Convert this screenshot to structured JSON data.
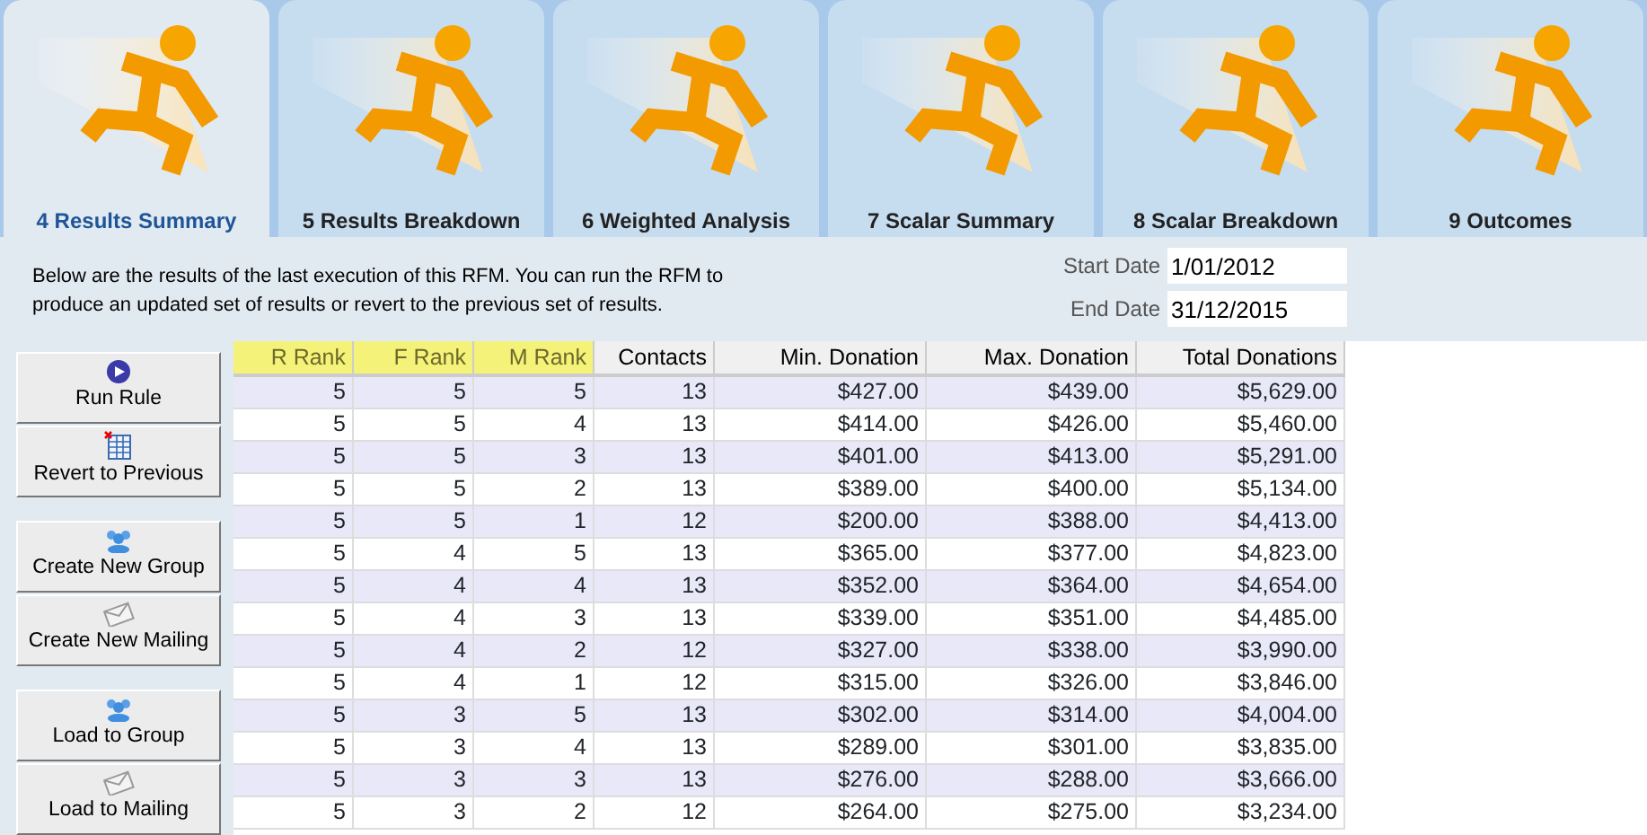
{
  "tabs": [
    {
      "label": "4 Results Summary",
      "selected": true
    },
    {
      "label": "5 Results Breakdown",
      "selected": false
    },
    {
      "label": "6 Weighted Analysis",
      "selected": false
    },
    {
      "label": "7 Scalar Summary",
      "selected": false
    },
    {
      "label": "8 Scalar Breakdown",
      "selected": false
    },
    {
      "label": "9 Outcomes",
      "selected": false
    }
  ],
  "description": "Below are the results of the last execution of this RFM. You can run the RFM to produce an updated set of results or revert to the previous set of results.",
  "date_fields": [
    {
      "label": "Start Date",
      "value": "1/01/2012"
    },
    {
      "label": "End Date",
      "value": "31/12/2015"
    }
  ],
  "action_groups": [
    [
      {
        "kind": "run",
        "label": "Run Rule"
      },
      {
        "kind": "revert",
        "label": "Revert to Previous"
      }
    ],
    [
      {
        "kind": "group",
        "label": "Create New Group"
      },
      {
        "kind": "mailing",
        "label": "Create New Mailing"
      }
    ],
    [
      {
        "kind": "group",
        "label": "Load to Group"
      },
      {
        "kind": "mailing",
        "label": "Load to Mailing"
      }
    ]
  ],
  "table": {
    "columns": [
      {
        "label": "R Rank",
        "highlighted": true
      },
      {
        "label": "F Rank",
        "highlighted": true
      },
      {
        "label": "M Rank",
        "highlighted": true
      },
      {
        "label": "Contacts",
        "highlighted": false
      },
      {
        "label": "Min. Donation",
        "highlighted": false
      },
      {
        "label": "Max. Donation",
        "highlighted": false
      },
      {
        "label": "Total Donations",
        "highlighted": false
      }
    ],
    "rows": [
      [
        "5",
        "5",
        "5",
        "13",
        "$427.00",
        "$439.00",
        "$5,629.00"
      ],
      [
        "5",
        "5",
        "4",
        "13",
        "$414.00",
        "$426.00",
        "$5,460.00"
      ],
      [
        "5",
        "5",
        "3",
        "13",
        "$401.00",
        "$413.00",
        "$5,291.00"
      ],
      [
        "5",
        "5",
        "2",
        "13",
        "$389.00",
        "$400.00",
        "$5,134.00"
      ],
      [
        "5",
        "5",
        "1",
        "12",
        "$200.00",
        "$388.00",
        "$4,413.00"
      ],
      [
        "5",
        "4",
        "5",
        "13",
        "$365.00",
        "$377.00",
        "$4,823.00"
      ],
      [
        "5",
        "4",
        "4",
        "13",
        "$352.00",
        "$364.00",
        "$4,654.00"
      ],
      [
        "5",
        "4",
        "3",
        "13",
        "$339.00",
        "$351.00",
        "$4,485.00"
      ],
      [
        "5",
        "4",
        "2",
        "12",
        "$327.00",
        "$338.00",
        "$3,990.00"
      ],
      [
        "5",
        "4",
        "1",
        "12",
        "$315.00",
        "$326.00",
        "$3,846.00"
      ],
      [
        "5",
        "3",
        "5",
        "13",
        "$302.00",
        "$314.00",
        "$4,004.00"
      ],
      [
        "5",
        "3",
        "4",
        "13",
        "$289.00",
        "$301.00",
        "$3,835.00"
      ],
      [
        "5",
        "3",
        "3",
        "13",
        "$276.00",
        "$288.00",
        "$3,666.00"
      ],
      [
        "5",
        "3",
        "2",
        "12",
        "$264.00",
        "$275.00",
        "$3,234.00"
      ]
    ]
  }
}
